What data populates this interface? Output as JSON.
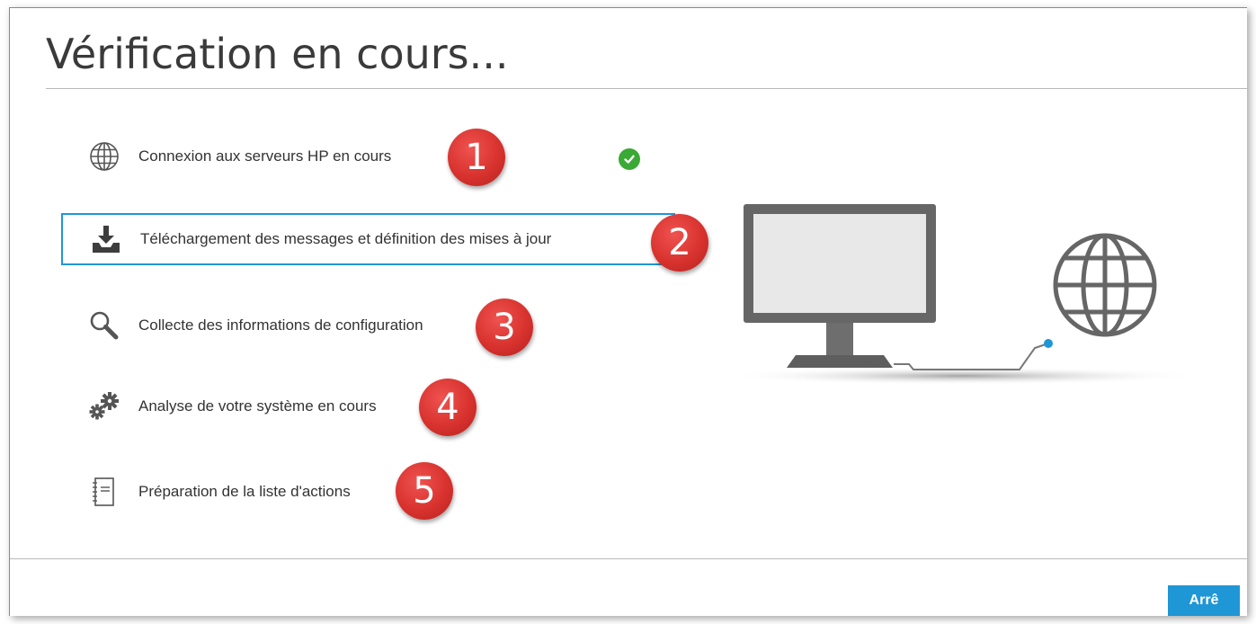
{
  "dialog": {
    "title": "Vérification en cours..."
  },
  "steps": [
    {
      "label": "Connexion aux serveurs HP en cours",
      "icon": "globe-icon",
      "badge": "1",
      "status": "done"
    },
    {
      "label": "Téléchargement des messages et définition des mises à jour",
      "icon": "download-icon",
      "badge": "2",
      "status": "active"
    },
    {
      "label": "Collecte des informations de configuration",
      "icon": "magnifier-icon",
      "badge": "3",
      "status": "pending"
    },
    {
      "label": "Analyse de votre système en cours",
      "icon": "gears-icon",
      "badge": "4",
      "status": "pending"
    },
    {
      "label": "Préparation de la liste d'actions",
      "icon": "notebook-icon",
      "badge": "5",
      "status": "pending"
    }
  ],
  "footer": {
    "button_label": "Arrê"
  },
  "colors": {
    "accent": "#1f96d6",
    "badge": "#d8322e",
    "success": "#3aa935",
    "icon": "#555555"
  }
}
